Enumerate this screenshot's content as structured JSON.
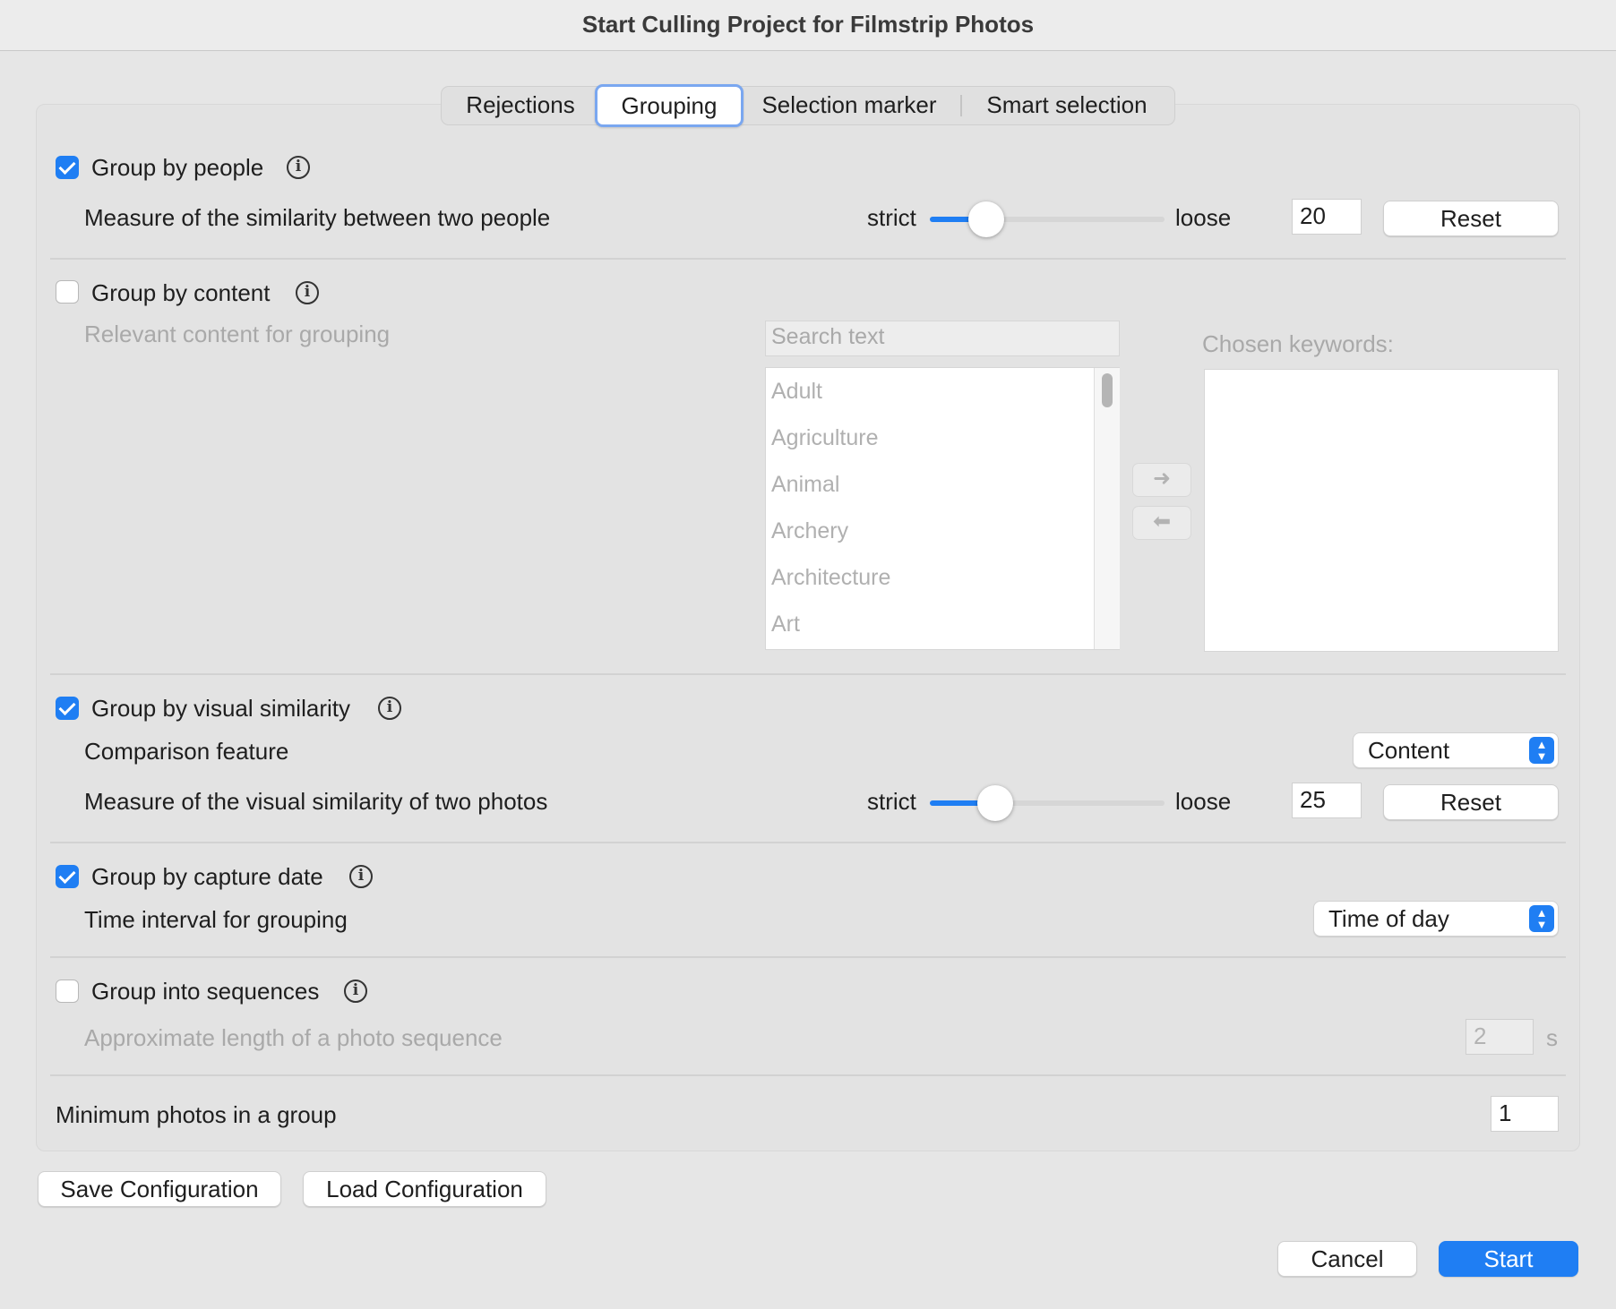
{
  "window": {
    "title": "Start Culling Project for Filmstrip Photos"
  },
  "tabs": [
    "Rejections",
    "Grouping",
    "Selection marker",
    "Smart selection"
  ],
  "active_tab": "Grouping",
  "people": {
    "label": "Group by people",
    "checked": true,
    "similarity_label": "Measure of the similarity between two people",
    "strict_label": "strict",
    "loose_label": "loose",
    "value": "20",
    "slider_fraction": 0.24,
    "reset_label": "Reset"
  },
  "content": {
    "label": "Group by content",
    "checked": false,
    "relevant_label": "Relevant content for grouping",
    "search_placeholder": "Search text",
    "chosen_label": "Chosen keywords:",
    "keywords": [
      "Adult",
      "Agriculture",
      "Animal",
      "Archery",
      "Architecture",
      "Art"
    ],
    "add_arrow": "➜",
    "remove_arrow": "⬅"
  },
  "visual": {
    "label": "Group by visual similarity",
    "checked": true,
    "feature_label": "Comparison feature",
    "feature_value": "Content",
    "similarity_label": "Measure of the visual similarity of two photos",
    "strict_label": "strict",
    "loose_label": "loose",
    "value": "25",
    "slider_fraction": 0.28,
    "reset_label": "Reset"
  },
  "capture": {
    "label": "Group by capture date",
    "checked": true,
    "interval_label": "Time interval for grouping",
    "interval_value": "Time of day"
  },
  "sequences": {
    "label": "Group into sequences",
    "checked": false,
    "length_label": "Approximate length of a photo sequence",
    "length_value": "2",
    "unit": "s"
  },
  "minimum": {
    "label": "Minimum photos in a group",
    "value": "1"
  },
  "footer": {
    "save": "Save Configuration",
    "load": "Load Configuration",
    "cancel": "Cancel",
    "start": "Start"
  },
  "colors": {
    "accent": "#1f7ef3",
    "panel": "#e3e3e3",
    "disabled_text": "#a9a9a9"
  }
}
